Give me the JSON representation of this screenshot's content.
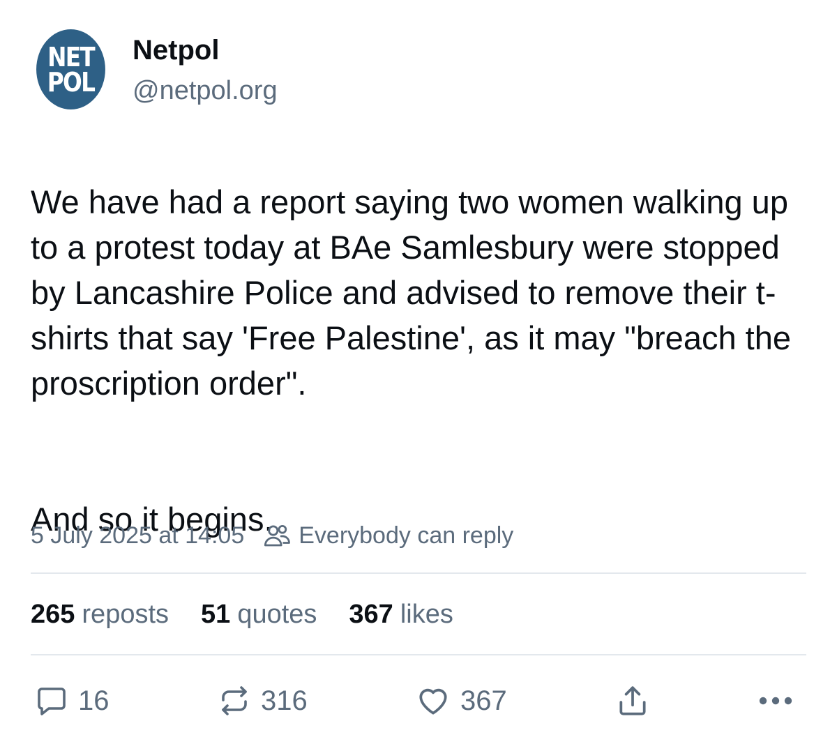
{
  "author": {
    "avatar_line1": "NET",
    "avatar_line2": "POL",
    "display_name": "Netpol",
    "handle": "@netpol.org",
    "avatar_color": "#2e6086"
  },
  "post": {
    "paragraph1": "We have had a report saying two women walking up to a protest today at BAe Samlesbury were stopped by Lancashire Police and advised to remove their t-shirts that say 'Free Palestine', as it may \"breach the proscription order\".",
    "paragraph2": "And so it begins.",
    "timestamp": "5 July 2025 at 14:05",
    "reply_setting": "Everybody can reply",
    "reply_setting_icon": "people-icon"
  },
  "stats": [
    {
      "count": "265",
      "label": "reposts"
    },
    {
      "count": "51",
      "label": "quotes"
    },
    {
      "count": "367",
      "label": "likes"
    }
  ],
  "actions": {
    "reply": {
      "icon": "reply-icon",
      "count": "16"
    },
    "repost": {
      "icon": "repost-icon",
      "count": "316"
    },
    "like": {
      "icon": "heart-icon",
      "count": "367"
    },
    "share": {
      "icon": "share-icon"
    },
    "more": {
      "icon": "more-icon"
    }
  },
  "colors": {
    "text": "#0b0f14",
    "muted": "#5b6b7c",
    "divider": "#e3e8ed"
  }
}
